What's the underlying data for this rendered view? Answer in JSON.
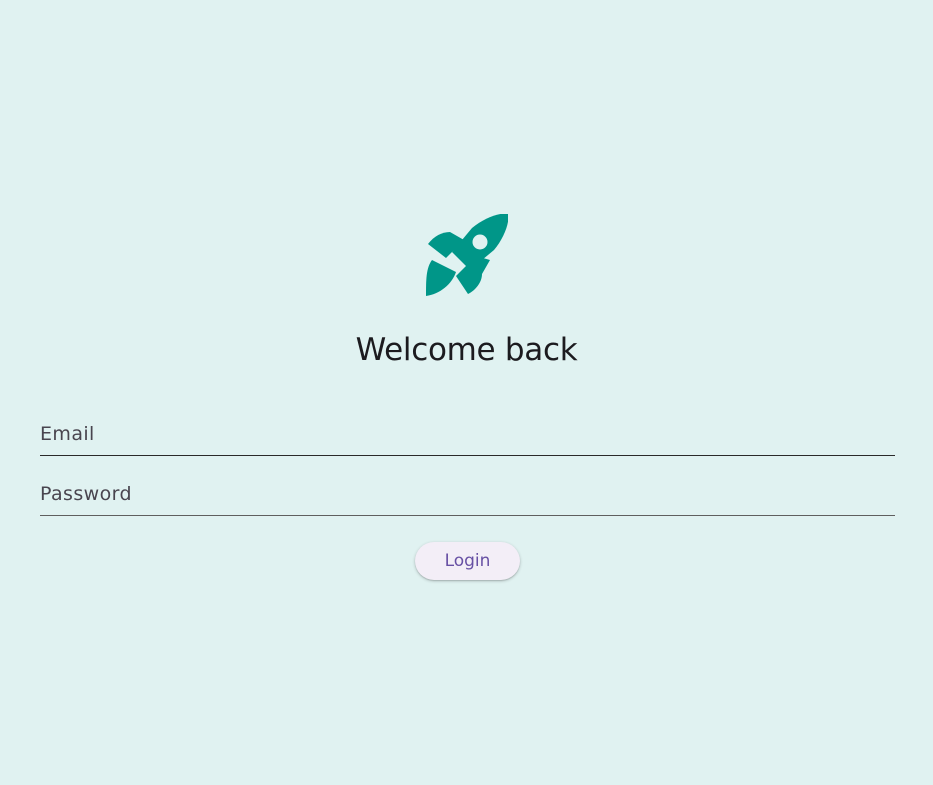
{
  "app": {
    "logo_icon": "rocket-icon",
    "accent_color": "#009688"
  },
  "header": {
    "title": "Welcome back"
  },
  "form": {
    "email": {
      "placeholder": "Email",
      "value": ""
    },
    "password": {
      "placeholder": "Password",
      "value": ""
    },
    "login_label": "Login"
  }
}
